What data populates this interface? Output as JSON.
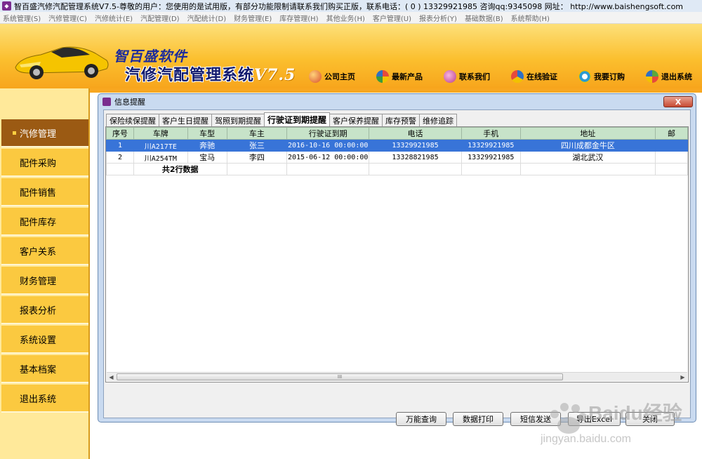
{
  "window": {
    "title": "智百盛汽修汽配管理系统V7.5-尊敬的用户：您使用的是试用版，有部分功能限制请联系我们购买正版，联系电话：( 0 ) 13329921985  咨询qq:9345098   网址：  http://www.baishengsoft.com"
  },
  "menu": [
    "系统管理(S)",
    "汽修管理(C)",
    "汽修统计(E)",
    "汽配管理(D)",
    "汽配统计(D)",
    "财务管理(E)",
    "库存管理(H)",
    "其他业务(H)",
    "客户管理(U)",
    "报表分析(Y)",
    "基础数据(B)",
    "系统帮助(H)"
  ],
  "header": {
    "logo_title": "智百盛软件",
    "logo_sub": "汽修汽配管理系统",
    "version": "V7.5",
    "nav": [
      {
        "label": "公司主页",
        "icon": "home-icon",
        "color": "#d9502d"
      },
      {
        "label": "最新产品",
        "icon": "product-icon",
        "color": "#3c9a3c"
      },
      {
        "label": "联系我们",
        "icon": "contact-icon",
        "color": "#b83c8c"
      },
      {
        "label": "在线验证",
        "icon": "verify-icon",
        "color": "#2f6fc4"
      },
      {
        "label": "我要订购",
        "icon": "order-icon",
        "color": "#2b9bd1"
      },
      {
        "label": "退出系统",
        "icon": "exit-icon",
        "color": "#5aa83c"
      }
    ]
  },
  "sidebar": {
    "items": [
      {
        "label": "汽修管理",
        "active": true
      },
      {
        "label": "配件采购"
      },
      {
        "label": "配件销售"
      },
      {
        "label": "配件库存"
      },
      {
        "label": "客户关系"
      },
      {
        "label": "财务管理"
      },
      {
        "label": "报表分析"
      },
      {
        "label": "系统设置"
      },
      {
        "label": "基本档案"
      },
      {
        "label": "退出系统"
      }
    ]
  },
  "dialog": {
    "title": "信息提醒",
    "close_label": "X",
    "tabs": [
      "保险续保提醒",
      "客户生日提醒",
      "驾照到期提醒",
      "行驶证到期提醒",
      "客户保养提醒",
      "库存预警",
      "维修追踪"
    ],
    "active_tab": "行驶证到期提醒",
    "table": {
      "columns": [
        "序号",
        "车牌",
        "车型",
        "车主",
        "行驶证到期",
        "电话",
        "手机",
        "地址",
        "邮"
      ],
      "rows": [
        [
          "1",
          "川A217TE",
          "奔驰",
          "张三",
          "2016-10-16 00:00:00",
          "13329921985",
          "13329921985",
          "四川成都金牛区",
          ""
        ],
        [
          "2",
          "川A254TM",
          "宝马",
          "李四",
          "2015-06-12 00:00:00",
          "13328821985",
          "13329921985",
          "湖北武汉",
          ""
        ]
      ],
      "summary": "共2行数据",
      "scroll_grip": "III"
    },
    "buttons": [
      "万能查询",
      "数据打印",
      "短信发送",
      "导出Excel",
      "关闭"
    ]
  },
  "watermark": {
    "brand": "Baidu经验",
    "url": "jingyan.baidu.com"
  }
}
